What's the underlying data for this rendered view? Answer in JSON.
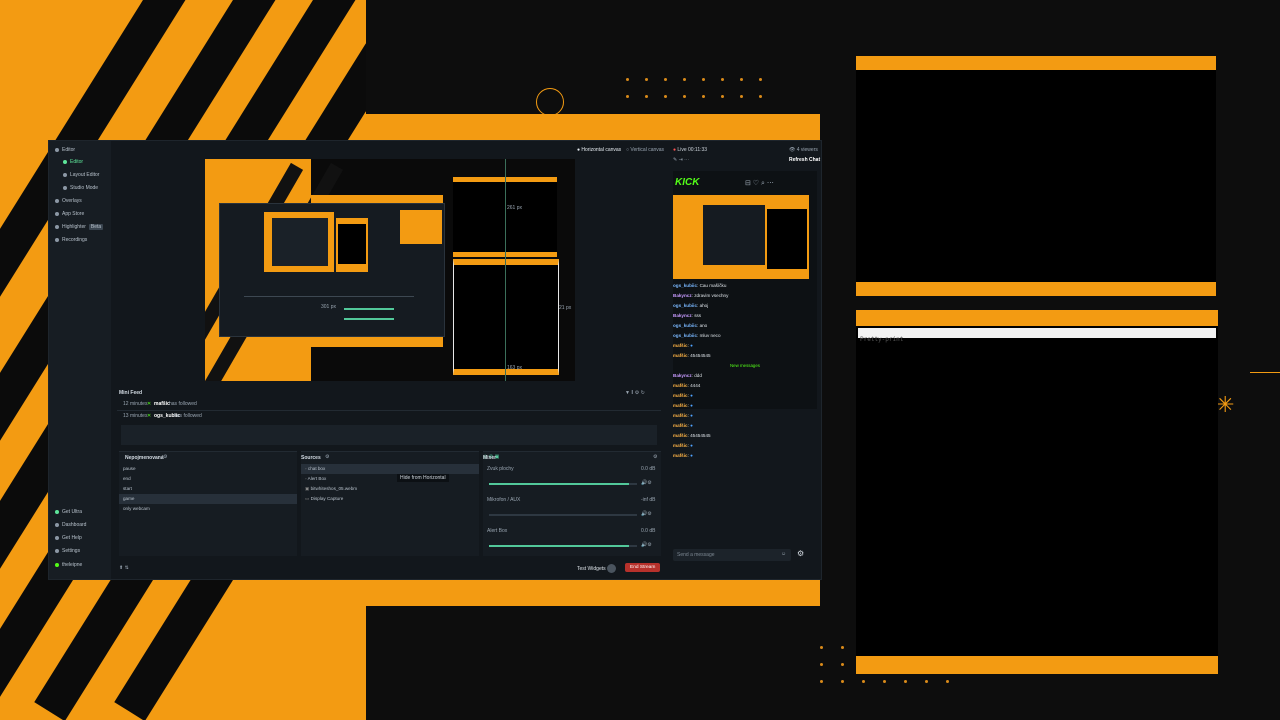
{
  "sidebar": {
    "items": [
      {
        "label": "Editor"
      },
      {
        "label": "Editor"
      },
      {
        "label": "Layout Editor"
      },
      {
        "label": "Studio Mode"
      },
      {
        "label": "Overlays"
      },
      {
        "label": "App Store"
      },
      {
        "label": "Highlighter"
      },
      {
        "label": "Recordings"
      }
    ],
    "highlighter_badge": "Beta",
    "bottom_items": [
      {
        "label": "Get Ultra"
      },
      {
        "label": "Dashboard"
      },
      {
        "label": "Get Help"
      },
      {
        "label": "Settings"
      },
      {
        "label": "theleipne"
      }
    ]
  },
  "canvas_tabs": {
    "horizontal": "Horizontal canvas",
    "vertical": "Vertical canvas"
  },
  "preview": {
    "measure_a": "261 px",
    "measure_b": "163 px",
    "measure_c": "301 px",
    "measure_d": "21 px"
  },
  "mini_feed": {
    "title": "Mini Feed",
    "rows": [
      {
        "time": "12 minutes",
        "user": "mafšic",
        "action": "has followed"
      },
      {
        "time": "13 minutes",
        "user": "ogs_kubiic",
        "action": "has followed"
      }
    ]
  },
  "scenes": {
    "title": "Nepojmenovaná",
    "items": [
      "pause",
      "end",
      "start",
      "game",
      "only webcam"
    ],
    "selected_index": 3
  },
  "sources": {
    "title": "Sources",
    "items": [
      "chat box",
      "Alert Box",
      "bitwhiteshos_05.webm",
      "Display Capture"
    ],
    "tooltip": "Hide from Horizontal"
  },
  "mixer": {
    "title": "Mixer",
    "channels": [
      {
        "name": "Zvuk plochy",
        "db": "0.0 dB",
        "level": 0.95
      },
      {
        "name": "Mikrofon / AUX",
        "db": "-inf dB",
        "level": 0.0
      },
      {
        "name": "Alert Box",
        "db": "0.0 dB",
        "level": 0.95
      }
    ]
  },
  "footer": {
    "test_widgets": "Test Widgets",
    "end_stream": "End Stream"
  },
  "chat": {
    "live_time": "Live 00:11:33",
    "viewers": "4 viewers",
    "refresh": "Refresh Chat",
    "brand": "KICK",
    "new_messages": "New messages",
    "input_placeholder": "Send a message",
    "messages": [
      {
        "user": "ogs_kubiic",
        "text": "Cau mašíčku",
        "kind": "b"
      },
      {
        "user": "Bakyncz",
        "text": "zdravim vsechny",
        "kind": "p"
      },
      {
        "user": "ogs_kubiic",
        "text": "ahoj",
        "kind": "b"
      },
      {
        "user": "Bakyncz",
        "text": "sss",
        "kind": "p"
      },
      {
        "user": "ogs_kubiic",
        "text": "ano",
        "kind": "b"
      },
      {
        "user": "ogs_kubiic",
        "text": "mluv neco",
        "kind": "b"
      },
      {
        "user": "mafšic",
        "text": "",
        "kind": "o"
      },
      {
        "user": "mafšic",
        "text": "45454545",
        "kind": "o"
      },
      {
        "user": "Bakyncz",
        "text": "ddd",
        "kind": "p"
      },
      {
        "user": "mafšic",
        "text": "4444",
        "kind": "o"
      },
      {
        "user": "mafšic",
        "text": "",
        "kind": "o"
      },
      {
        "user": "mafšic",
        "text": "",
        "kind": "o"
      },
      {
        "user": "mafšic",
        "text": "",
        "kind": "o"
      },
      {
        "user": "mafšic",
        "text": "",
        "kind": "o"
      },
      {
        "user": "mafšic",
        "text": "45454545",
        "kind": "o"
      },
      {
        "user": "mafšic",
        "text": "",
        "kind": "o"
      },
      {
        "user": "mafšic",
        "text": "",
        "kind": "o"
      }
    ]
  },
  "browser_source": {
    "text": "Pretty-print"
  },
  "colors": {
    "brand_orange": "#f39b12",
    "kick_green": "#53fc18",
    "accent_green": "#52c89a",
    "end_red": "#b7312b"
  }
}
